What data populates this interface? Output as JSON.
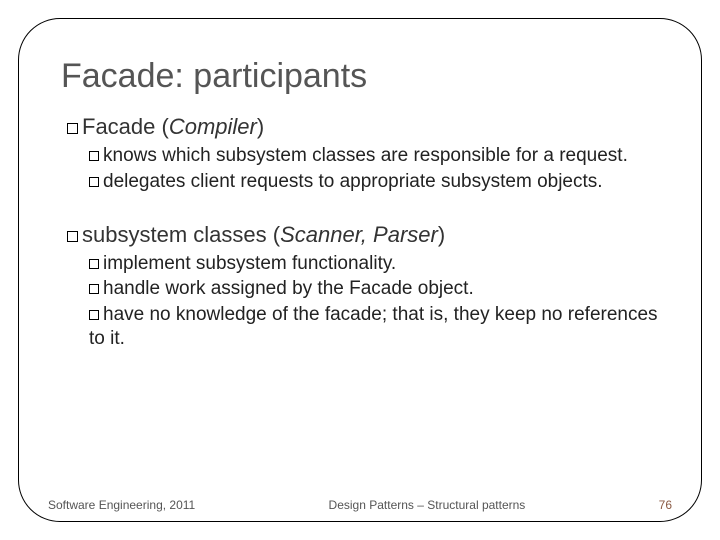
{
  "title": "Facade: participants",
  "sections": [
    {
      "label": "Facade",
      "paren": "Compiler",
      "subs": [
        "knows which subsystem classes are responsible for a request.",
        "delegates client requests to appropriate subsystem objects."
      ]
    },
    {
      "label": "subsystem classes",
      "paren": "Scanner, Parser",
      "subs": [
        "implement subsystem functionality.",
        "handle work assigned by the Facade object.",
        "have no knowledge of the facade; that is, they keep no references to it."
      ]
    }
  ],
  "footer": {
    "left": "Software Engineering, 2011",
    "center": "Design Patterns – Structural patterns",
    "right": "76"
  }
}
